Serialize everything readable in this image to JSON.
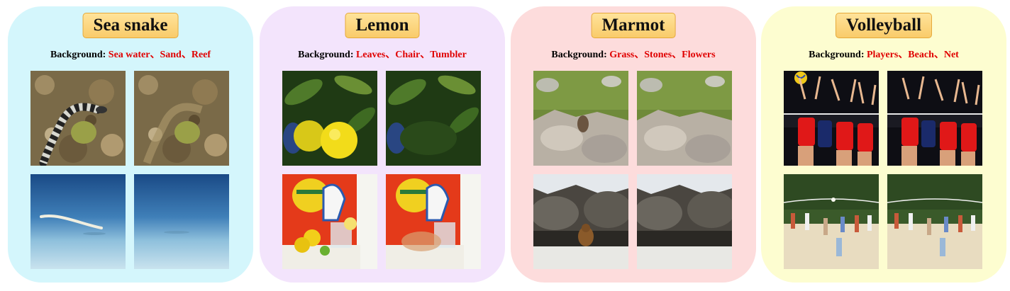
{
  "panels": [
    {
      "title": "Sea snake",
      "background_label": "Background:",
      "background_items": "Sea water、Sand、Reef",
      "color": "#d4f6fc",
      "images": [
        {
          "scene": "sea-snake-on-reef",
          "state": "original"
        },
        {
          "scene": "sea-snake-on-reef",
          "state": "object-removed"
        },
        {
          "scene": "sea-snake-on-sand",
          "state": "original"
        },
        {
          "scene": "sea-snake-on-sand",
          "state": "object-removed"
        }
      ]
    },
    {
      "title": "Lemon",
      "background_label": "Background:",
      "background_items": "Leaves、Chair、Tumbler",
      "color": "#f3e4fc",
      "images": [
        {
          "scene": "lemons-on-tree",
          "state": "original"
        },
        {
          "scene": "lemons-on-tree",
          "state": "object-removed"
        },
        {
          "scene": "lemons-on-chair",
          "state": "original"
        },
        {
          "scene": "lemons-on-chair",
          "state": "object-removed"
        }
      ]
    },
    {
      "title": "Marmot",
      "background_label": "Background:",
      "background_items": "Grass、Stones、Flowers",
      "color": "#fddcdc",
      "images": [
        {
          "scene": "marmot-in-meadow",
          "state": "original"
        },
        {
          "scene": "marmot-in-meadow",
          "state": "object-removed"
        },
        {
          "scene": "marmot-by-rocks",
          "state": "original"
        },
        {
          "scene": "marmot-by-rocks",
          "state": "object-removed"
        }
      ]
    },
    {
      "title": "Volleyball",
      "background_label": "Background:",
      "background_items": "Players、Beach、Net",
      "color": "#fdfdd0",
      "images": [
        {
          "scene": "indoor-volleyball",
          "state": "original"
        },
        {
          "scene": "indoor-volleyball",
          "state": "object-removed"
        },
        {
          "scene": "beach-volleyball",
          "state": "original"
        },
        {
          "scene": "beach-volleyball",
          "state": "object-removed"
        }
      ]
    }
  ]
}
